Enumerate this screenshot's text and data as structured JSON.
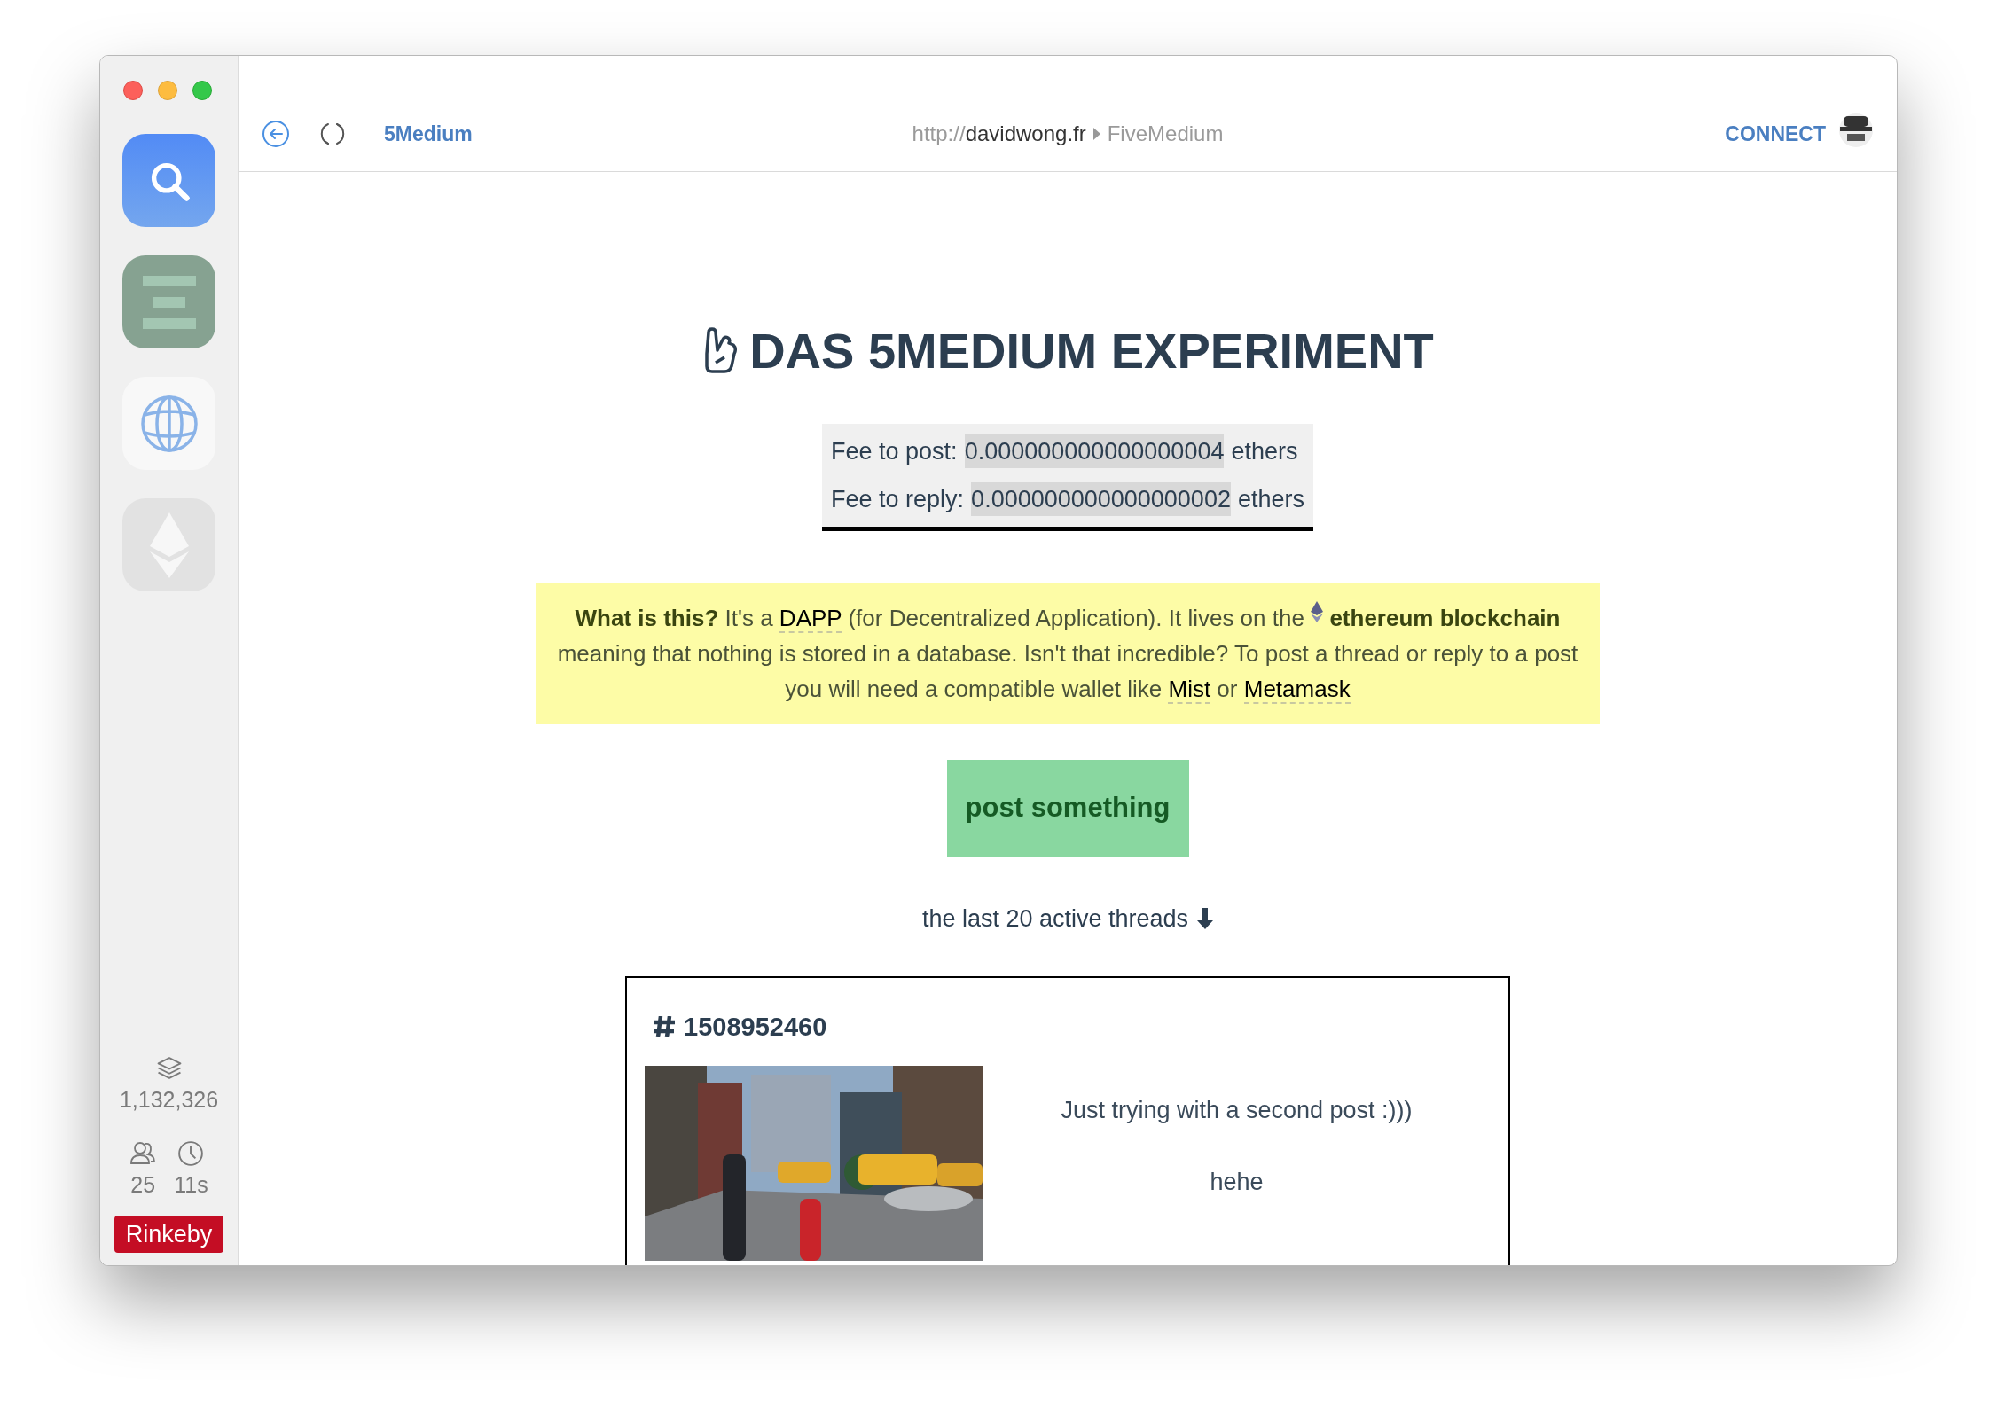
{
  "sidebar": {
    "apps": [
      {
        "kind": "search"
      },
      {
        "kind": "dapp"
      },
      {
        "kind": "browser"
      },
      {
        "kind": "wallet"
      }
    ],
    "stats": {
      "blocks": "1,132,326",
      "peers": "25",
      "last_block": "11s"
    },
    "network": "Rinkeby"
  },
  "toolbar": {
    "app_name": "5Medium",
    "url": {
      "scheme": "http://",
      "host": "davidwong.fr",
      "page": "FiveMedium"
    },
    "connect": "CONNECT"
  },
  "page": {
    "title": "DAS 5MEDIUM EXPERIMENT",
    "fees": [
      {
        "label": "Fee to post:",
        "amount": "0.000000000000000004",
        "unit": "ethers"
      },
      {
        "label": "Fee to reply:",
        "amount": "0.000000000000000002",
        "unit": "ethers"
      }
    ],
    "notice": [
      {
        "kind": "text",
        "text": "**What is this?** It's a "
      },
      {
        "kind": "link",
        "text": "DAPP"
      },
      {
        "kind": "text",
        "text": " (for Decentralized Application). It lives on the "
      },
      {
        "kind": "ether_icon"
      },
      {
        "kind": "text",
        "text": " **ethereum blockchain** meaning that nothing is stored in a database. Isn't that incredible? To post a thread or reply to a post you will need a compatible wallet like "
      },
      {
        "kind": "link",
        "text": "Mist"
      },
      {
        "kind": "text",
        "text": " or "
      },
      {
        "kind": "link",
        "text": "Metamask"
      }
    ],
    "post_button": "post something",
    "threads_label": "the last 20 active threads",
    "threads": [
      {
        "id": "1508952460",
        "lines": [
          "Just trying with a second post :)))",
          "hehe"
        ]
      }
    ]
  }
}
